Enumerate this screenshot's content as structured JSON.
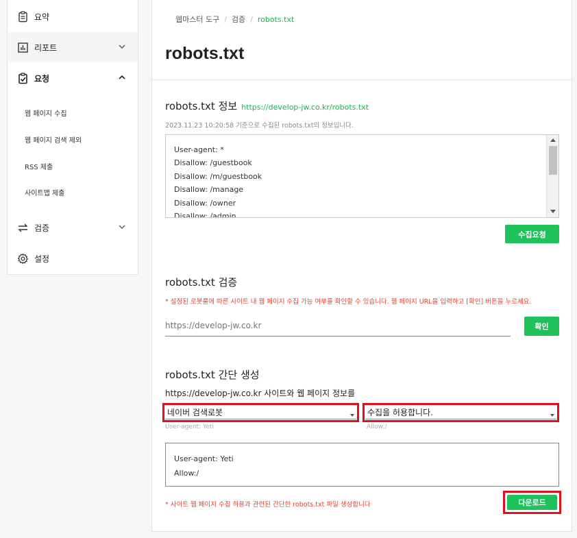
{
  "sidebar": {
    "items": [
      {
        "label": "요약"
      },
      {
        "label": "리포트"
      },
      {
        "label": "요청"
      },
      {
        "label": "검증"
      },
      {
        "label": "설정"
      }
    ],
    "subitems": [
      {
        "label": "웹 페이지 수집"
      },
      {
        "label": "웹 페이지 검색 제외"
      },
      {
        "label": "RSS 제출"
      },
      {
        "label": "사이트맵 제출"
      }
    ]
  },
  "breadcrumb": {
    "root": "웹마스터 도구",
    "sep": "/",
    "middle": "검증",
    "current": "robots.txt"
  },
  "page": {
    "title": "robots.txt"
  },
  "info": {
    "title": "robots.txt 정보",
    "url": "https://develop-jw.co.kr/robots.txt",
    "meta": "2023.11.23 10:20:58 기준으로 수집된 robots.txt의 정보입니다.",
    "lines": [
      "User-agent: *",
      "Disallow: /guestbook",
      "Disallow: /m/guestbook",
      "Disallow: /manage",
      "Disallow: /owner",
      "Disallow: /admin"
    ],
    "collect_button": "수집요청"
  },
  "verify": {
    "title": "robots.txt 검증",
    "warning": "* 설정된 로봇룰에 따른 사이트 내 웹 페이지 수집 가능 여부를 확인할 수 있습니다. 웹 페이지 URL을 입력하고 [확인] 버튼을 누르세요.",
    "placeholder": "https://develop-jw.co.kr",
    "confirm_button": "확인"
  },
  "generate": {
    "title": "robots.txt 간단 생성",
    "desc": "https://develop-jw.co.kr 사이트와 웹 페이지 정보를",
    "robot_select": "네이버 검색로봇",
    "robot_hint": "User-agent: Yeti",
    "allow_select": "수집을 허용합니다.",
    "allow_hint": "Allow:/",
    "output_lines": [
      "User-agent: Yeti",
      "Allow:/"
    ],
    "warning": "* 사이트 웹 페이지 수집 허용과 관련된 간단한 robots.txt 파일 생성합니다",
    "download_button": "다운로드"
  },
  "colors": {
    "accent": "#1ec15a",
    "link": "#1fb24c",
    "warning": "#e8412c",
    "highlight_border": "#e1111c"
  },
  "icons": {
    "summary": "clipboard-icon",
    "report": "bar-chart-icon",
    "request": "clipboard-check-icon",
    "verify": "swap-arrows-icon",
    "settings": "gear-icon"
  }
}
